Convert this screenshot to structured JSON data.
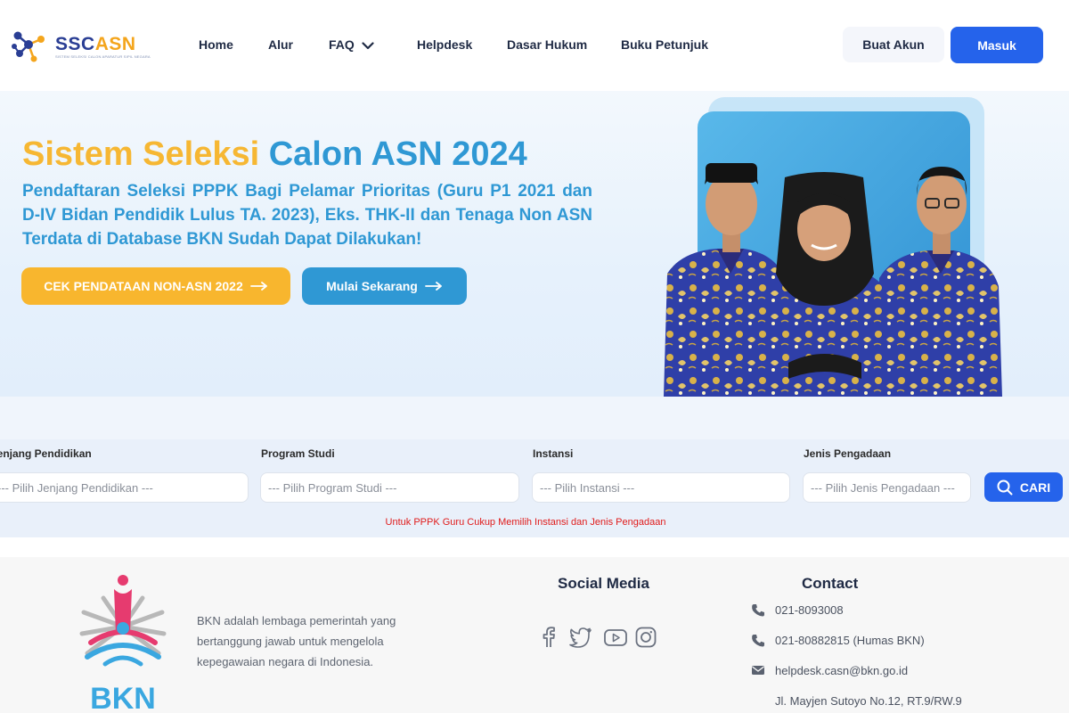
{
  "brand": {
    "logo_text_a": "SSC",
    "logo_text_b": "ASN",
    "logo_tagline": "SISTEM SELEKSI CALON APARATUR SIPIL NEGARA"
  },
  "nav": {
    "home": "Home",
    "alur": "Alur",
    "faq": "FAQ",
    "helpdesk": "Helpdesk",
    "dasar_hukum": "Dasar Hukum",
    "buku_petunjuk": "Buku Petunjuk"
  },
  "auth": {
    "register": "Buat Akun",
    "login": "Masuk"
  },
  "hero": {
    "title_part1": "Sistem Seleksi",
    "title_part2": "Calon ASN 2024",
    "subtitle": "Pendaftaran Seleksi PPPK Bagi Pelamar Prioritas (Guru P1 2021 dan D-IV Bidan Pendidik Lulus TA. 2023), Eks. THK-II dan Tenaga Non ASN Terdata di Database BKN Sudah Dapat Dilakukan!",
    "btn_primary": "CEK PENDATAAN NON-ASN 2022",
    "btn_secondary": "Mulai Sekarang"
  },
  "filter": {
    "jenjang_label": "Jenjang Pendidikan",
    "jenjang_placeholder": "--- Pilih Jenjang Pendidikan ---",
    "prodi_label": "Program Studi",
    "prodi_placeholder": "--- Pilih Program Studi ---",
    "instansi_label": "Instansi",
    "instansi_placeholder": "--- Pilih Instansi ---",
    "pengadaan_label": "Jenis Pengadaan",
    "pengadaan_placeholder": "--- Pilih Jenis Pengadaan ---",
    "search_button": "CARI",
    "note": "Untuk PPPK Guru Cukup Memilih Instansi dan Jenis Pengadaan"
  },
  "footer": {
    "bkn_logo_text": "BKN",
    "description": "BKN adalah lembaga pemerintah yang bertanggung jawab untuk mengelola kepegawaian negara di Indonesia.",
    "social_heading": "Social Media",
    "social_icons": [
      "facebook-icon",
      "twitter-icon",
      "youtube-icon",
      "instagram-icon"
    ],
    "contact_heading": "Contact",
    "phone1": "021-8093008",
    "phone2": "021-80882815 (Humas BKN)",
    "email": "helpdesk.casn@bkn.go.id",
    "address": "Jl. Mayjen Sutoyo No.12, RT.9/RW.9"
  },
  "colors": {
    "accent_blue": "#2563eb",
    "hero_yellow": "#f6b733",
    "hero_blue": "#2f98d4",
    "note_red": "#e01b1b",
    "batik_blue": "#2f3fa8"
  }
}
